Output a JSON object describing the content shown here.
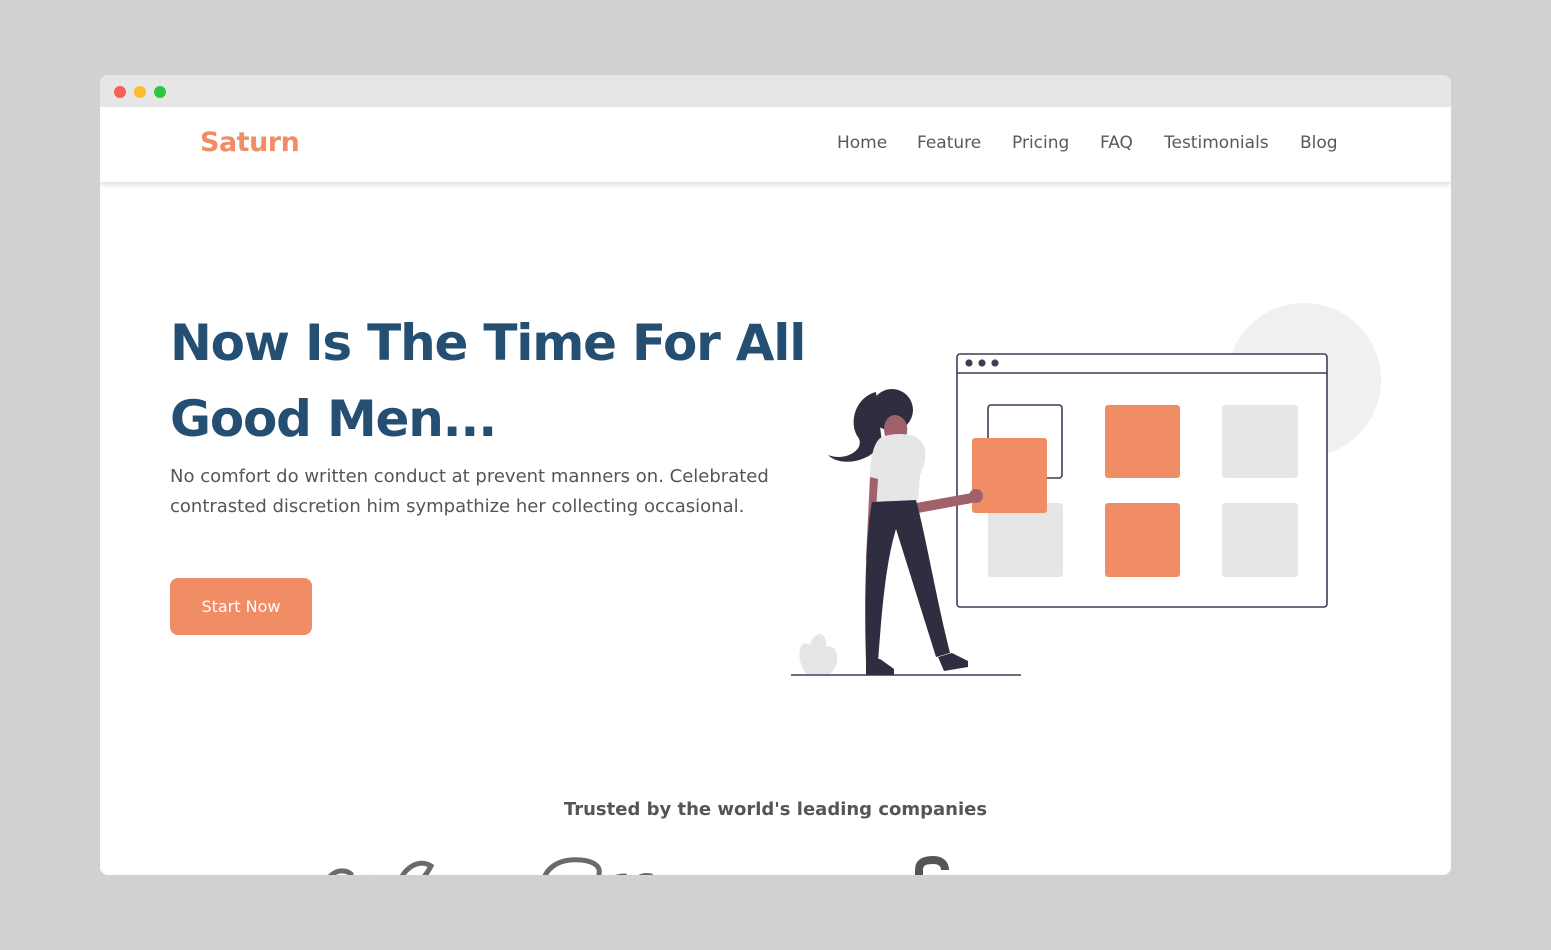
{
  "brand": {
    "name": "Saturn",
    "color": "#f08d65"
  },
  "nav": {
    "items": [
      {
        "label": "Home"
      },
      {
        "label": "Feature"
      },
      {
        "label": "Pricing"
      },
      {
        "label": "FAQ"
      },
      {
        "label": "Testimonials"
      },
      {
        "label": "Blog"
      }
    ]
  },
  "hero": {
    "title": "Now Is The Time For All Good Men...",
    "description": "No comfort do written conduct at prevent manners on. Celebrated contrasted discretion him sympathize her collecting occasional.",
    "cta_label": "Start Now"
  },
  "trusted": {
    "heading": "Trusted by the world's leading companies",
    "logos": [
      {
        "name": "Coca-Cola",
        "icon": "coca-cola-logo"
      },
      {
        "name": "Pepsi",
        "icon": "pepsi-logo"
      },
      {
        "name": "P",
        "icon": "partial-logo"
      }
    ]
  },
  "colors": {
    "accent": "#f08d65",
    "heading": "#254f72",
    "body_text": "#555555",
    "illustration_dark": "#2f2e41"
  }
}
